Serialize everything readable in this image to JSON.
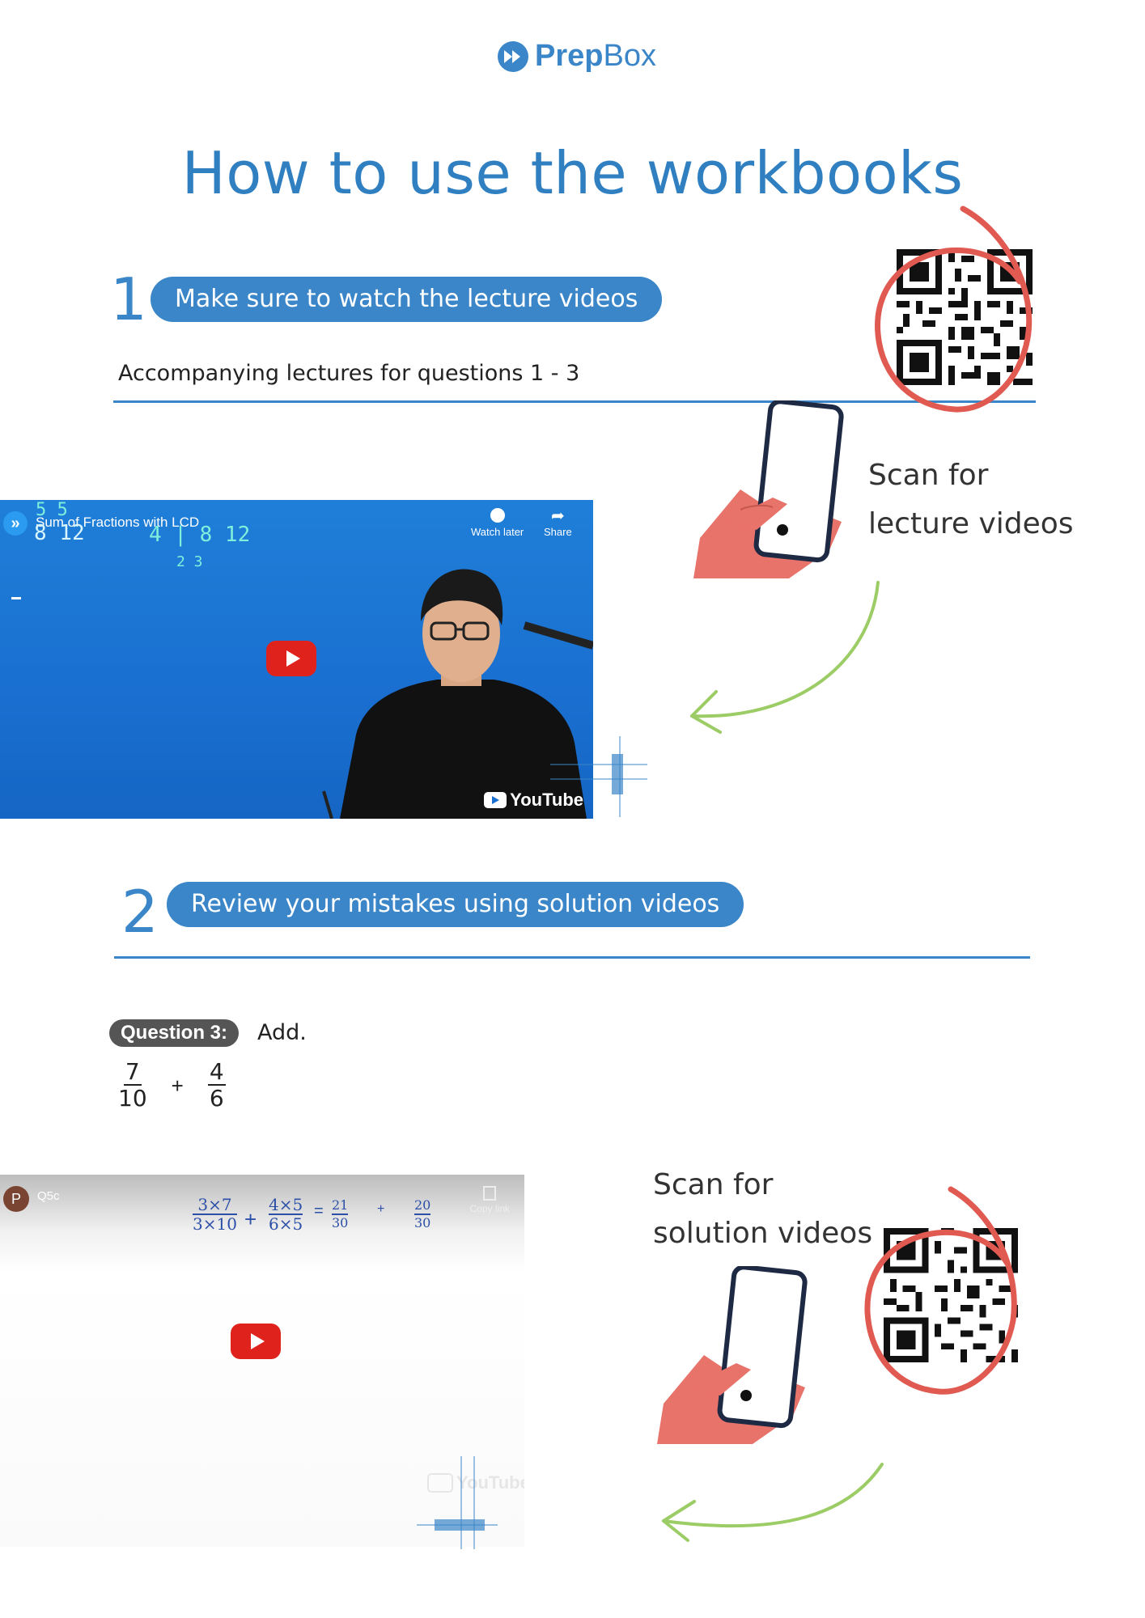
{
  "logo": {
    "bold": "Prep",
    "regular": "Box"
  },
  "title": "How to use the workbooks",
  "step1": {
    "number": "1",
    "pill": "Make sure to watch the lecture videos",
    "subtitle": "Accompanying lectures for questions 1 - 3",
    "scan_line1": "Scan for",
    "scan_line2": "lecture videos"
  },
  "video1": {
    "title": "Sum of Fractions with LCD",
    "watch_later": "Watch later",
    "share": "Share",
    "youtube": "YouTube",
    "board_left": "5 5",
    "board_nums": "8 12",
    "board_div": "4 | 8   12",
    "board_res": "2   3"
  },
  "step2": {
    "number": "2",
    "pill": "Review your mistakes using solution videos",
    "scan_line1": "Scan for",
    "scan_line2": "solution videos"
  },
  "question": {
    "badge": "Question 3:",
    "text": "Add.",
    "frac1_num": "7",
    "frac1_den": "10",
    "op": "+",
    "frac2_num": "4",
    "frac2_den": "6"
  },
  "video2": {
    "avatar": "P",
    "title": "Q5c",
    "copy_link": "Copy link",
    "youtube": "YouTube",
    "ink1": "3×7",
    "ink1b": "3×10",
    "ink2": "4×5",
    "ink2b": "6×5",
    "ink3": "21",
    "ink3b": "30",
    "ink4": "20",
    "ink4b": "30"
  },
  "colors": {
    "brand": "#3a86c8",
    "qr_circle": "#e05a52",
    "arrow": "#9ccc65",
    "hand": "#e8736a"
  }
}
